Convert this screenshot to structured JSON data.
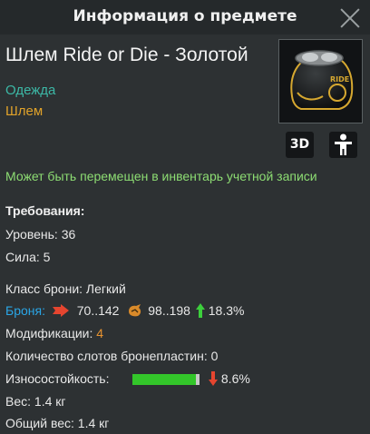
{
  "window": {
    "title": "Информация о предмете"
  },
  "item": {
    "name": "Шлем Ride or Die - Золотой",
    "category": "Одежда",
    "subcategory": "Шлем",
    "btn_3d": "3D",
    "notice": "Может быть перемещен в инвентарь учетной записи"
  },
  "requirements": {
    "title": "Требования:",
    "level": "Уровень: 36",
    "strength": "Сила: 5"
  },
  "stats": {
    "armor_class": "Класс брони: Легкий",
    "armor_label": "Броня:",
    "armor_pierce": "70..142",
    "armor_blunt": "98..198",
    "armor_change": "18.3%",
    "mods_label": "Модификации:",
    "mods_value": "4",
    "plates": "Количество слотов бронепластин: 0",
    "durability_label": "Износостойкость:",
    "durability_fraction": 0.95,
    "durability_change": "8.6%",
    "weight": "Вес: 1.4 кг",
    "total_weight": "Общий вес: 1.4 кг"
  },
  "colors": {
    "category": "#3cb8a6",
    "subcategory": "#e0a22a",
    "notice": "#8ddd73",
    "armor_label": "#2aa6e6",
    "increase": "#3ccf3c",
    "decrease": "#e5452f",
    "durability_bar": "#33c62a"
  },
  "icons": [
    "close-icon",
    "helmet-image",
    "3d-view-button",
    "character-preview-icon",
    "pierce-damage-icon",
    "blunt-damage-icon",
    "arrow-up-icon",
    "arrow-down-icon"
  ]
}
